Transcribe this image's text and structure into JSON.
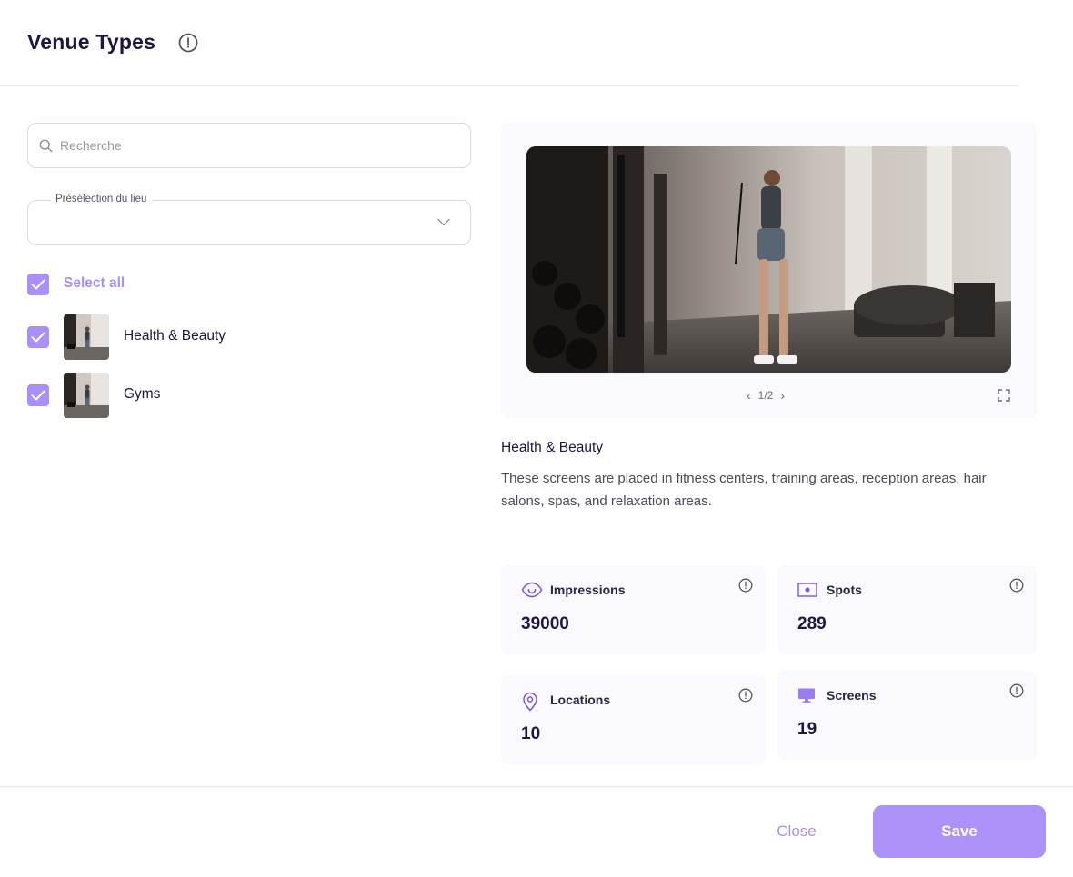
{
  "header": {
    "title": "Venue Types",
    "info_icon": "info-icon"
  },
  "search": {
    "placeholder": "Recherche",
    "value": ""
  },
  "preselect": {
    "label": "Présélection du lieu",
    "value": ""
  },
  "select_all": {
    "label": "Select all",
    "checked": true
  },
  "venues": [
    {
      "label": "Health & Beauty",
      "checked": true
    },
    {
      "label": "Gyms",
      "checked": true
    }
  ],
  "preview": {
    "page_indicator": "1/2"
  },
  "description": {
    "title": "Health & Beauty",
    "text": "These screens are placed in fitness centers, training areas, reception areas, hair salons, spas, and relaxation areas."
  },
  "stats": {
    "impressions": {
      "label": "Impressions",
      "value": "39000",
      "icon": "eye-icon"
    },
    "spots": {
      "label": "Spots",
      "value": "289",
      "icon": "spot-icon"
    },
    "locations": {
      "label": "Locations",
      "value": "10",
      "icon": "location-pin-icon"
    },
    "screens": {
      "label": "Screens",
      "value": "19",
      "icon": "monitor-icon"
    }
  },
  "footer": {
    "close_label": "Close",
    "save_label": "Save"
  },
  "colors": {
    "accent": "#a98ff7",
    "title": "#1c1642",
    "panel": "#faf9fe"
  }
}
